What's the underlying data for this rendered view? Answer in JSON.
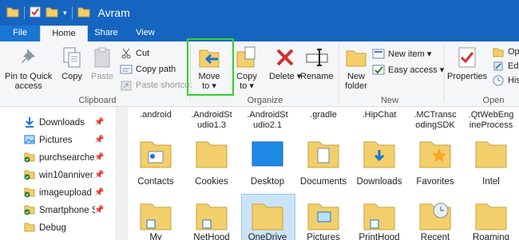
{
  "window": {
    "title": "Avram"
  },
  "tabs": [
    {
      "label": "File"
    },
    {
      "label": "Home"
    },
    {
      "label": "Share"
    },
    {
      "label": "View"
    }
  ],
  "ribbon": {
    "clipboard": {
      "pin_label_1": "Pin to Quick",
      "pin_label_2": "access",
      "copy": "Copy",
      "paste": "Paste",
      "cut": "Cut",
      "copy_path": "Copy path",
      "paste_shortcut": "Paste shortcut",
      "group": "Clipboard"
    },
    "organize": {
      "move_to_1": "Move",
      "move_to_2": "to ▾",
      "copy_to_1": "Copy",
      "copy_to_2": "to ▾",
      "delete": "Delete ▾",
      "rename": "Rename",
      "group": "Organize"
    },
    "new": {
      "new_folder_1": "New",
      "new_folder_2": "folder",
      "new_item": "New item ▾",
      "easy_access": "Easy access ▾",
      "group": "New"
    },
    "open": {
      "properties": "Properties",
      "open_partial": "Op",
      "edit_partial": "Edi",
      "history_partial": "His",
      "group": "Open"
    }
  },
  "nav": {
    "items": [
      {
        "label": "Downloads",
        "icon": "download-arrow-icon"
      },
      {
        "label": "Pictures",
        "icon": "pictures-icon"
      },
      {
        "label": "purchsearche",
        "icon": "green-check-folder-icon"
      },
      {
        "label": "win10anniver",
        "icon": "green-check-folder-icon"
      },
      {
        "label": "imageupload",
        "icon": "green-check-folder-icon"
      },
      {
        "label": "Smartphone S",
        "icon": "green-check-folder-icon"
      },
      {
        "label": "Debug",
        "icon": "folder-icon"
      }
    ]
  },
  "content": {
    "top_row": [
      ".android",
      ".AndroidSt\nudio1.3",
      ".AndroidSt\nudio2.1",
      ".gradle",
      ".HipChat",
      ".MCTransc\nodingSDK",
      ".QtWebEng\nineProcess"
    ],
    "row2": [
      "Contacts",
      "Cookies",
      "Desktop",
      "Documents",
      "Downloads",
      "Favorites",
      "Intel"
    ],
    "row3": [
      "My",
      "NetHood",
      "OneDrive",
      "Pictures",
      "PrintHood",
      "Recent",
      "Roaming"
    ]
  },
  "colors": {
    "titlebar": "#1565c0",
    "ribbon_bg": "#f5f6f7",
    "highlight": "#2fd12f",
    "folder": "#f3cf6b"
  }
}
